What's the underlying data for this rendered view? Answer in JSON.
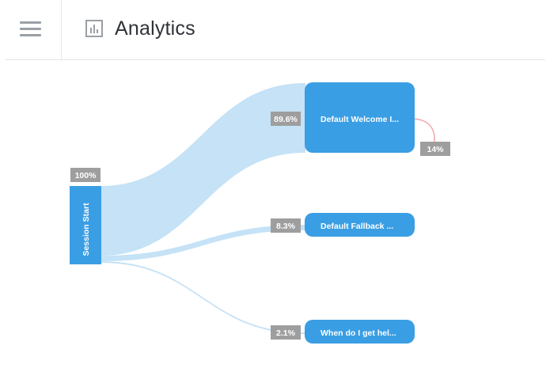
{
  "header": {
    "title": "Analytics",
    "menu_icon": "hamburger-menu-icon",
    "title_icon": "bar-chart-icon"
  },
  "colors": {
    "node": "#3a9ee4",
    "flow": "#c5e2f6",
    "badge": "#9e9e9e",
    "loop": "#f0a6ad"
  },
  "flow": {
    "source": {
      "label": "Session Start",
      "percent": "100%"
    },
    "targets": [
      {
        "label": "Default Welcome I...",
        "percent": "89.6%"
      },
      {
        "label": "Default Fallback ...",
        "percent": "8.3%"
      },
      {
        "label": "When do I get hel...",
        "percent": "2.1%"
      }
    ],
    "loop": {
      "percent": "14%"
    }
  }
}
